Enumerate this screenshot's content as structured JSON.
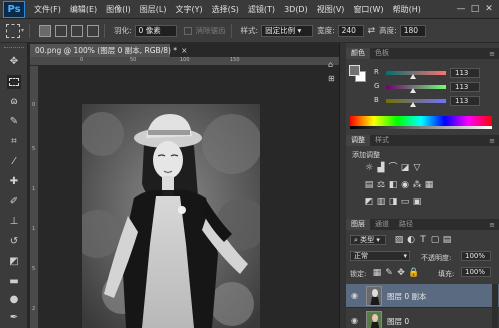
{
  "app": {
    "logo": "Ps"
  },
  "menu": [
    "文件(F)",
    "编辑(E)",
    "图像(I)",
    "图层(L)",
    "文字(Y)",
    "选择(S)",
    "滤镜(T)",
    "3D(D)",
    "视图(V)",
    "窗口(W)",
    "帮助(H)"
  ],
  "window_controls": {
    "minimize": "—",
    "maximize": "□",
    "close": "✕"
  },
  "options_bar": {
    "feather_label": "羽化:",
    "feather_value": "0 像素",
    "antialias_label": "消除锯齿",
    "style_label": "样式:",
    "style_value": "固定比例",
    "width_label": "宽度:",
    "width_value": "240",
    "height_label": "高度:",
    "height_value": "180"
  },
  "document": {
    "tab_title": "00.png @ 100% (图层 0 副本, RGB/8) *",
    "close": "×",
    "ruler_top_labels": [
      "0",
      "50",
      "100",
      "150"
    ],
    "ruler_left_labels": [
      "0",
      "5",
      "1",
      "1",
      "5",
      "2"
    ]
  },
  "panels": {
    "color_tabs": [
      "颜色",
      "色板"
    ],
    "color_rows": [
      {
        "label": "R",
        "value": "113",
        "fraction": 0.443
      },
      {
        "label": "G",
        "value": "113",
        "fraction": 0.443
      },
      {
        "label": "B",
        "value": "113",
        "fraction": 0.443
      }
    ],
    "adjust_tabs": [
      "调整",
      "样式"
    ],
    "adjust_title": "添加调整",
    "layers_tabs": [
      "图层",
      "通道",
      "路径"
    ],
    "kind_value": "类型",
    "blend_value": "正常",
    "opacity_label": "不透明度:",
    "opacity_value": "100%",
    "lock_label": "锁定:",
    "fill_label": "填充:",
    "fill_value": "100%",
    "layers": [
      {
        "name": "图层 0 副本",
        "selected": true
      },
      {
        "name": "图层 0",
        "selected": false
      }
    ]
  },
  "colors": {
    "selected_layer": "#5a6a80",
    "foreground": "#717171",
    "background": "#ffffff",
    "accent_blue": "#2c8be0"
  }
}
